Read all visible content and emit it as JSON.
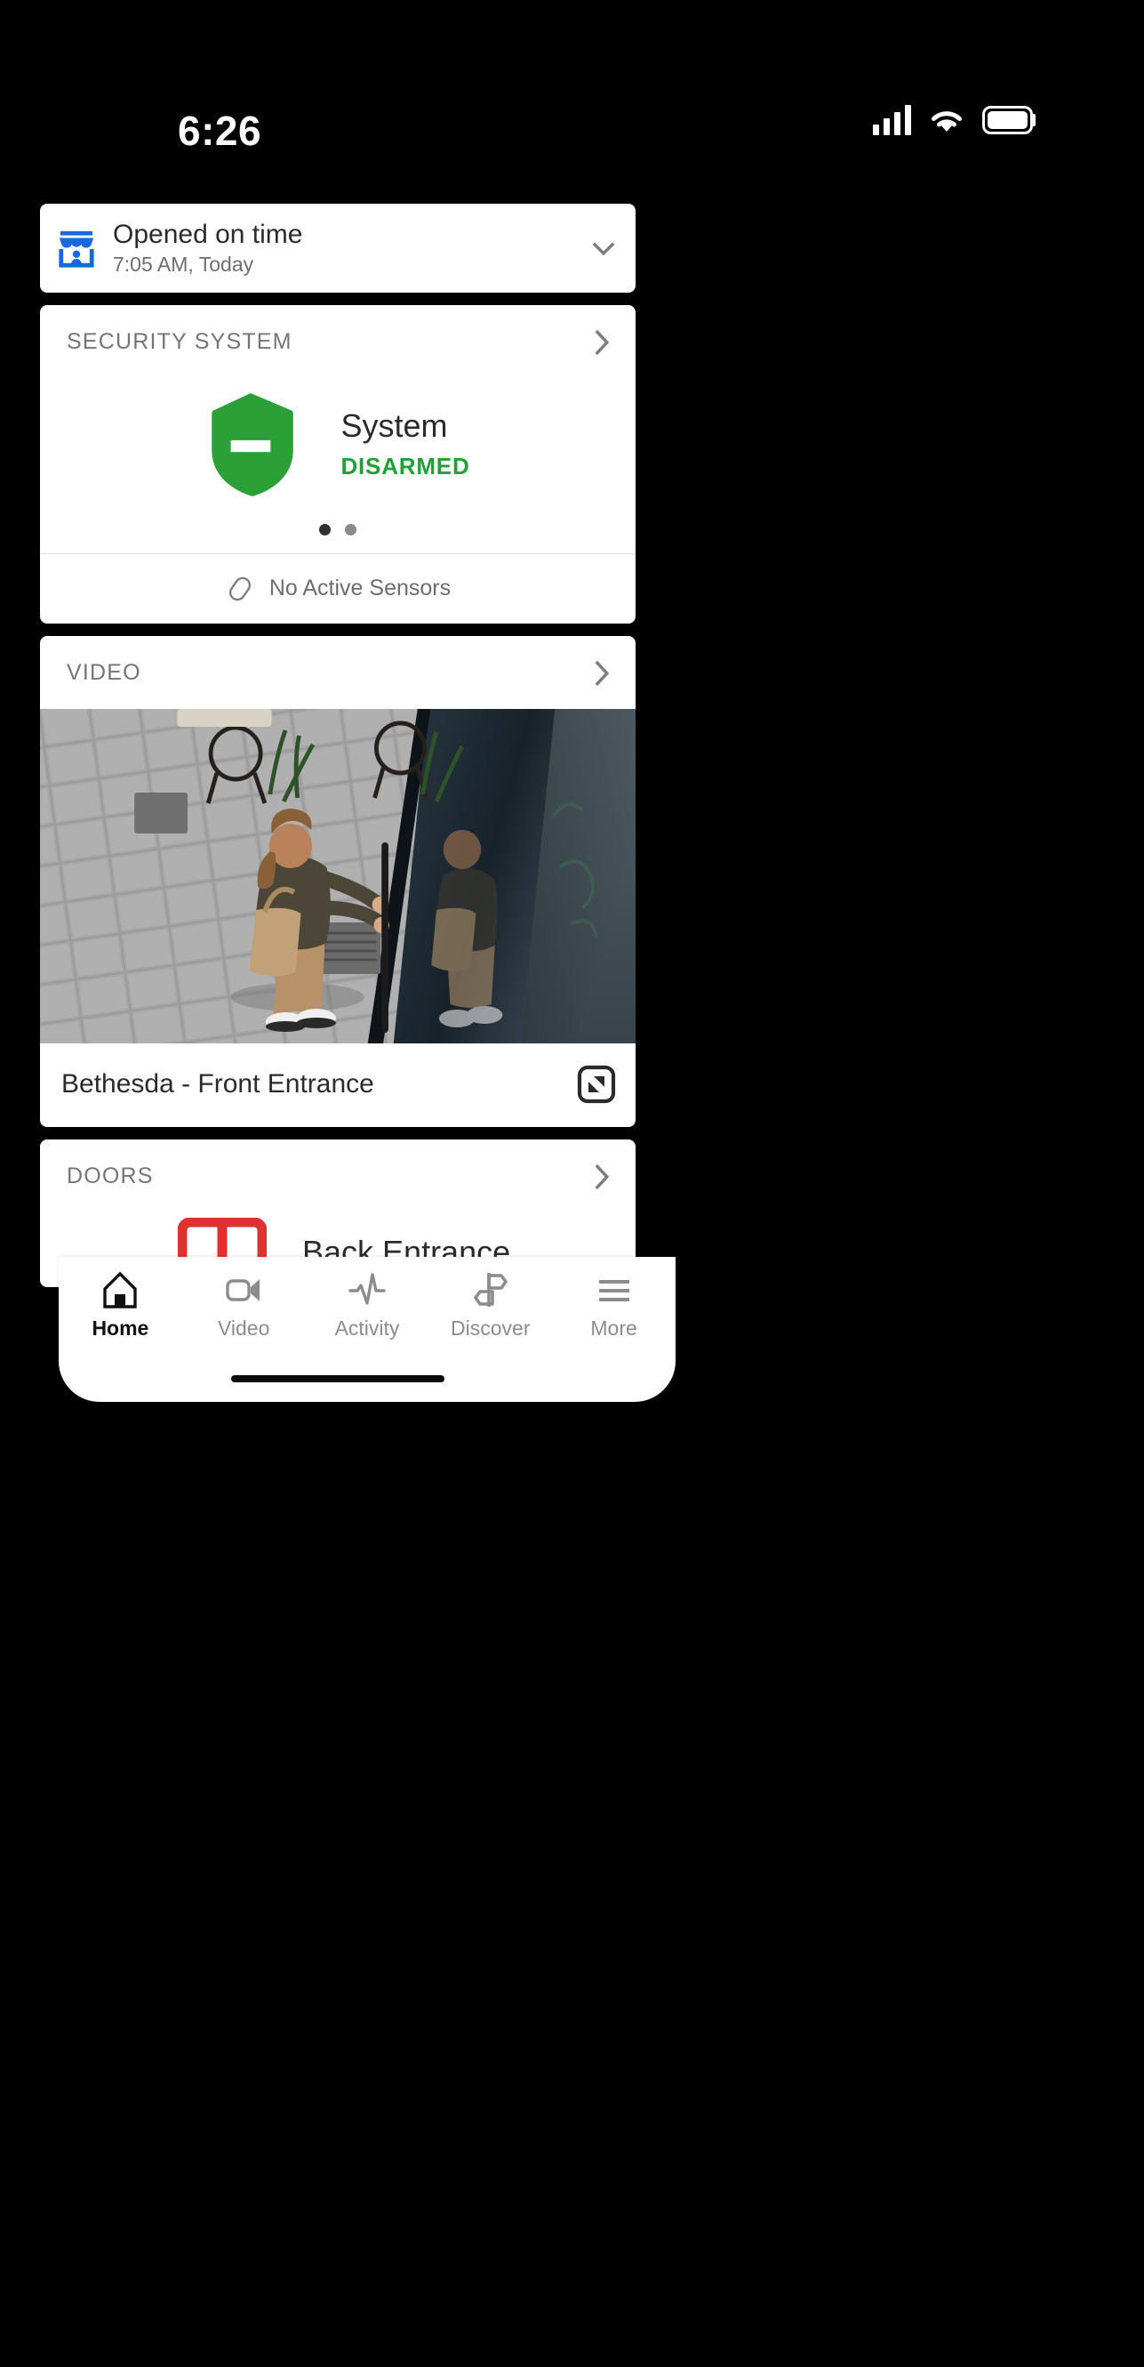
{
  "status_bar": {
    "time": "6:26",
    "icons": {
      "signal": "signal-bars-icon",
      "wifi": "wifi-icon",
      "battery": "battery-icon"
    }
  },
  "status_card": {
    "icon": "storefront-icon",
    "title": "Opened on time",
    "subtitle": "7:05 AM, Today",
    "chevron": "chevron-down-icon",
    "icon_color": "#1769e0"
  },
  "security": {
    "header": "SECURITY SYSTEM",
    "chevron": "chevron-right-icon",
    "shield_icon": "shield-disarmed-icon",
    "shield_color": "#2ba037",
    "system_label": "System",
    "state": "DISARMED",
    "state_color": "#21a038",
    "pager": {
      "total": 2,
      "active": 1
    },
    "sensors_icon": "sensor-icon",
    "sensors_text": "No Active Sensors"
  },
  "video": {
    "header": "VIDEO",
    "chevron": "chevron-right-icon",
    "camera_name": "Bethesda - Front Entrance",
    "expand_icon": "expand-fullscreen-icon"
  },
  "doors": {
    "header": "DOORS",
    "chevron": "chevron-right-icon",
    "door_icon": "door-icon",
    "door_icon_color": "#e03131",
    "door_name": "Back Entrance"
  },
  "tabbar": {
    "items": [
      {
        "icon": "home-icon",
        "label": "Home",
        "active": true
      },
      {
        "icon": "video-camera-icon",
        "label": "Video",
        "active": false
      },
      {
        "icon": "activity-pulse-icon",
        "label": "Activity",
        "active": false
      },
      {
        "icon": "discover-signpost-icon",
        "label": "Discover",
        "active": false
      },
      {
        "icon": "more-hamburger-icon",
        "label": "More",
        "active": false
      }
    ]
  }
}
